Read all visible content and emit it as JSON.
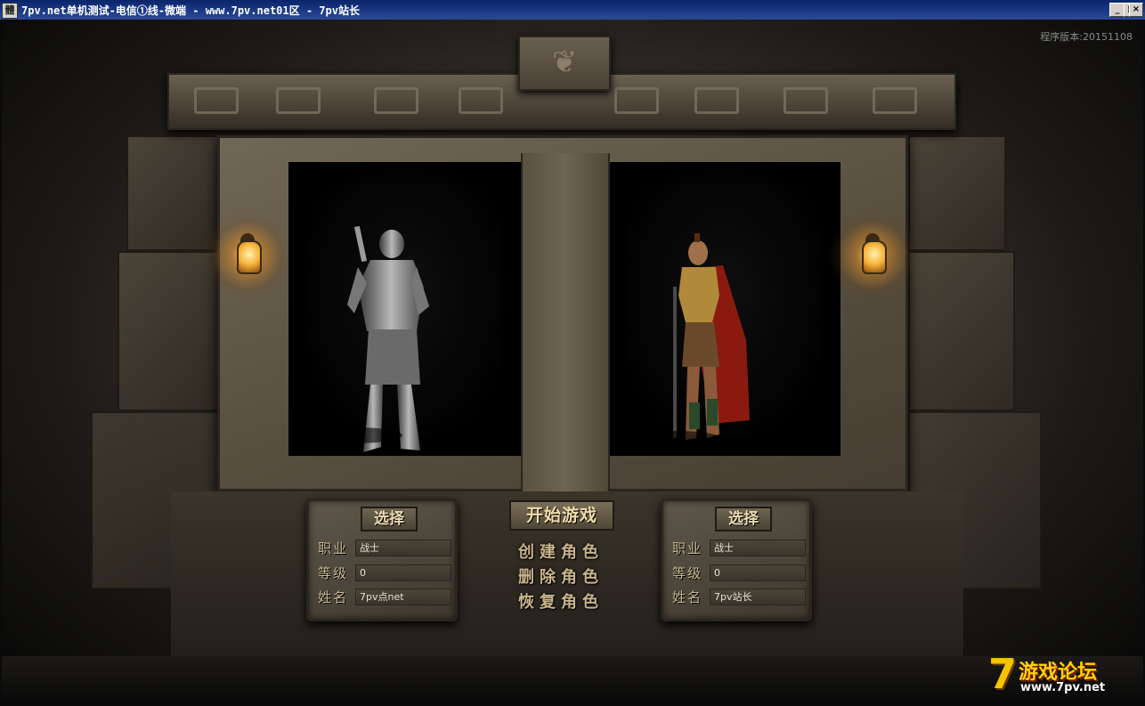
{
  "window": {
    "title": "7pv.net单机测试-电信①线-微端 - www.7pv.net01区 - 7pv站长",
    "minimize": "_",
    "maximize": "□",
    "close": "×",
    "app_icon_glyph": "體"
  },
  "version": "程序版本:20151108",
  "slots": [
    {
      "select_label": "选择",
      "class_label": "职业",
      "class_value": "战士",
      "level_label": "等级",
      "level_value": "0",
      "name_label": "姓名",
      "name_value": "7pv点net"
    },
    {
      "select_label": "选择",
      "class_label": "职业",
      "class_value": "战士",
      "level_label": "等级",
      "level_value": "0",
      "name_label": "姓名",
      "name_value": "7pv站长"
    }
  ],
  "menu": {
    "start_game": "开始游戏",
    "create_role": "创建角色",
    "delete_role": "删除角色",
    "restore_role": "恢复角色"
  },
  "watermark": {
    "seven": "7",
    "text": "游戏论坛",
    "url": "www.7pv.net"
  },
  "colors": {
    "titlebar": "#0a246a",
    "stone": "#5a5140",
    "torch": "#f5b23a",
    "logo": "#f5c400"
  }
}
